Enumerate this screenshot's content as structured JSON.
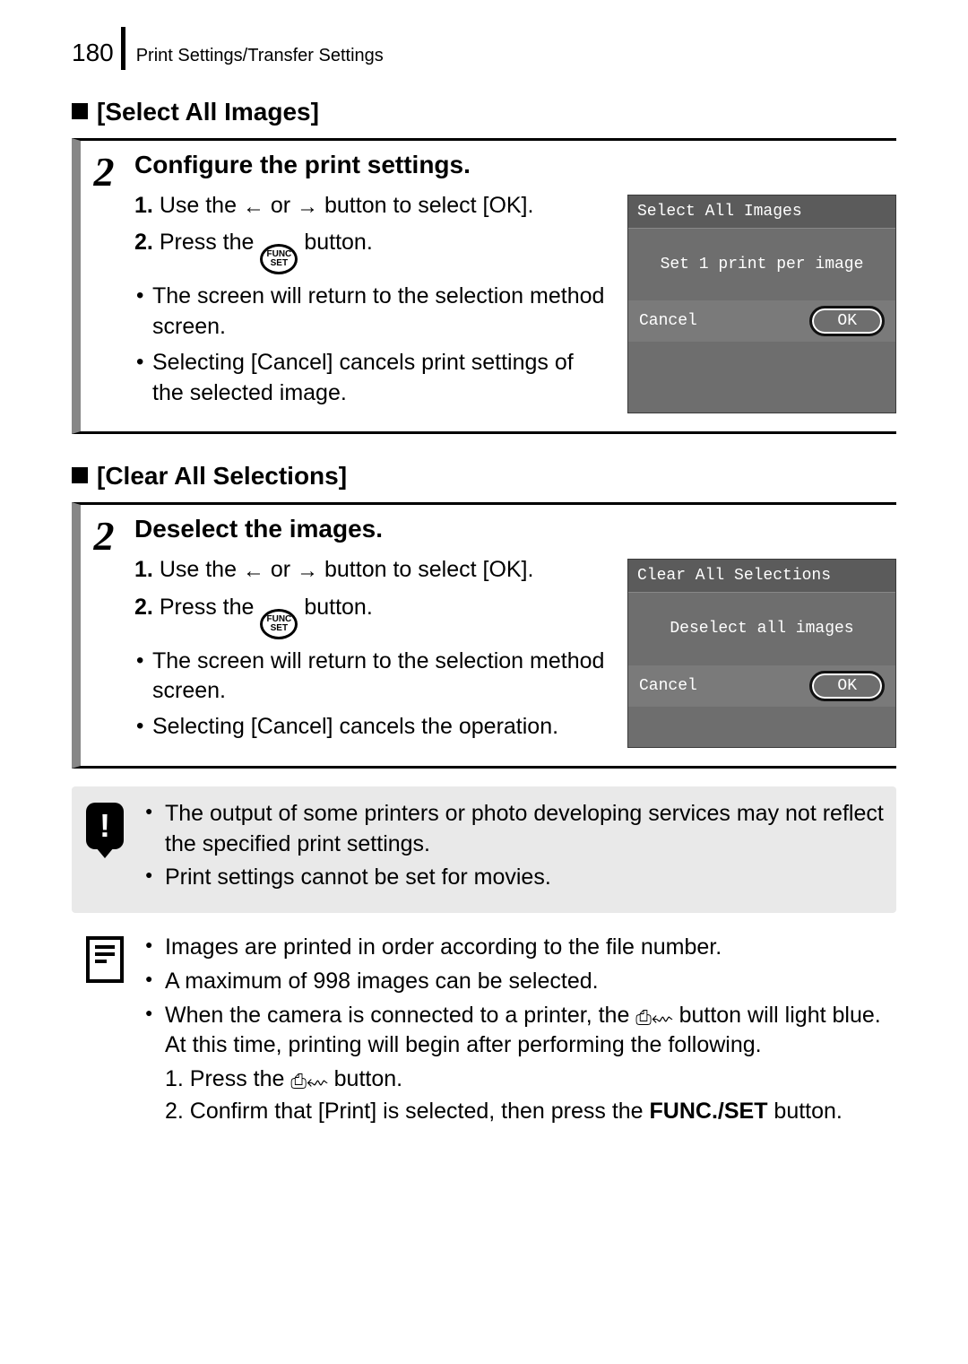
{
  "page_number": "180",
  "header": "Print Settings/Transfer Settings",
  "section1": {
    "heading": "[Select All Images]",
    "step_number": "2",
    "step_title": "Configure the print settings.",
    "ol": [
      {
        "n": "1.",
        "pre": "Use the ",
        "mid": " or ",
        "post": " button to select [OK]."
      },
      {
        "n": "2.",
        "pre": "Press the ",
        "post": " button."
      }
    ],
    "bullets": [
      "The screen will return to the selection method screen.",
      "Selecting [Cancel] cancels print settings of the selected image."
    ],
    "lcd": {
      "title": "Select All Images",
      "body": "Set 1 print per image",
      "cancel": "Cancel",
      "ok": "OK"
    }
  },
  "section2": {
    "heading": "[Clear All Selections]",
    "step_number": "2",
    "step_title": "Deselect the images.",
    "ol": [
      {
        "n": "1.",
        "pre": "Use the ",
        "mid": " or ",
        "post": " button to select [OK]."
      },
      {
        "n": "2.",
        "pre": "Press the ",
        "post": " button."
      }
    ],
    "bullets": [
      "The screen will return to the selection method screen.",
      "Selecting [Cancel] cancels the operation."
    ],
    "lcd": {
      "title": "Clear All Selections",
      "body": "Deselect all images",
      "cancel": "Cancel",
      "ok": "OK"
    }
  },
  "warning": {
    "items": [
      "The output of some printers or photo developing services may not reflect the specified print settings.",
      "Print settings cannot be set for movies."
    ]
  },
  "info": {
    "b1": "Images are printed in order according to the file number.",
    "b2": "A maximum of 998 images can be selected.",
    "b3_pre": "When the camera is connected to a printer, the ",
    "b3_post": " button will light blue. At this time, printing will begin after performing the following.",
    "sub1_pre": "1. Press the ",
    "sub1_post": " button.",
    "sub2_pre": "2. Confirm that [Print] is selected, then press the ",
    "sub2_bold": "FUNC./SET",
    "sub2_post": " button."
  },
  "glyphs": {
    "arrow_left": "←",
    "arrow_right": "→",
    "func_top": "FUNC",
    "func_bot": "SET",
    "print": "⎙⇜"
  }
}
